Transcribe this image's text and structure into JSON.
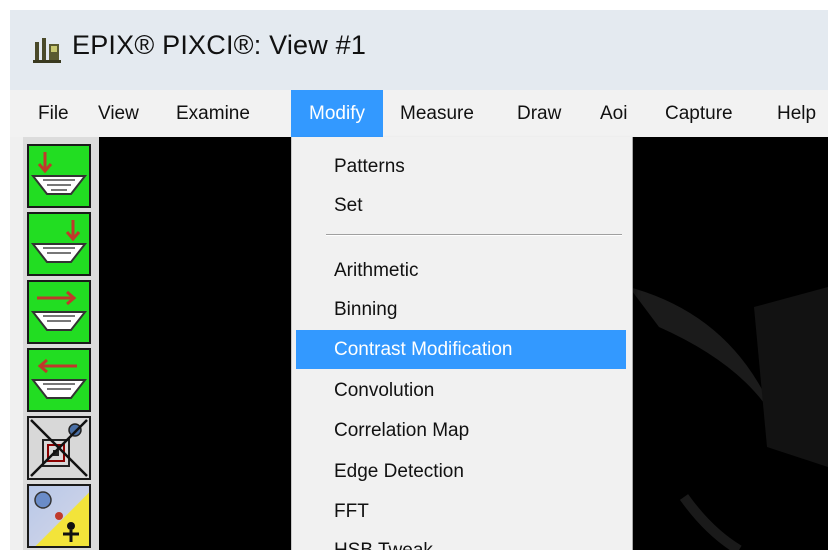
{
  "window": {
    "title": "EPIX® PIXCI®: View #1",
    "app_icon": "epix-app-icon"
  },
  "menubar": {
    "items": [
      "File",
      "View",
      "Examine",
      "Modify",
      "Measure",
      "Draw",
      "Aoi",
      "Capture",
      "Help"
    ],
    "active": "Modify"
  },
  "toolbar": {
    "buttons": [
      {
        "icon": "capture-down-arrow-icon",
        "color": "#22dd22"
      },
      {
        "icon": "capture-down-arrow-right-icon",
        "color": "#22dd22"
      },
      {
        "icon": "arrow-right-icon",
        "color": "#22dd22"
      },
      {
        "icon": "arrow-left-icon",
        "color": "#22dd22"
      },
      {
        "icon": "crossed-out-tool-icon",
        "color": "#d8d8d8"
      },
      {
        "icon": "person-tool-icon",
        "color": "#f3e43a"
      }
    ]
  },
  "modify_menu": {
    "items": [
      "Patterns",
      "Set",
      "Arithmetic",
      "Binning",
      "Contrast Modification",
      "Convolution",
      "Correlation Map",
      "Edge Detection",
      "FFT",
      "HSB Tweak"
    ],
    "highlighted": "Contrast Modification"
  },
  "colors": {
    "highlight": "#3399ff",
    "toolbar_green": "#22dd22",
    "viewport": "#000000"
  }
}
